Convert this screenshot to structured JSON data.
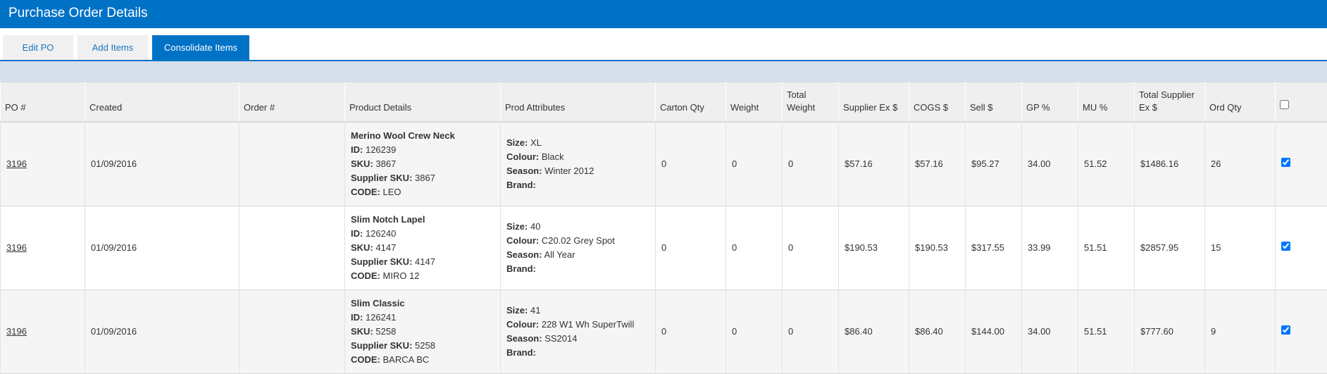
{
  "header": {
    "title": "Purchase Order Details"
  },
  "tabs": [
    {
      "label": "Edit PO",
      "active": false
    },
    {
      "label": "Add Items",
      "active": false
    },
    {
      "label": "Consolidate Items",
      "active": true
    }
  ],
  "table": {
    "columns": [
      "PO #",
      "Created",
      "Order #",
      "Product Details",
      "Prod Attributes",
      "Carton Qty",
      "Weight",
      "Total Weight",
      "Supplier Ex $",
      "COGS $",
      "Sell $",
      "GP %",
      "MU %",
      "Total Supplier Ex $",
      "Ord Qty"
    ],
    "header_checked": false,
    "detail_labels": {
      "id": "ID:",
      "sku": "SKU:",
      "supplier_sku": "Supplier SKU:",
      "code": "CODE:"
    },
    "attr_labels": {
      "size": "Size:",
      "colour": "Colour:",
      "season": "Season:",
      "brand": "Brand:"
    },
    "rows": [
      {
        "po": "3196",
        "created": "01/09/2016",
        "order": "",
        "name": "Merino Wool Crew Neck",
        "id": "126239",
        "sku": "3867",
        "supplier_sku": "3867",
        "code": "LEO",
        "size": "XL",
        "colour": "Black",
        "season": "Winter 2012",
        "brand": "",
        "carton_qty": "0",
        "weight": "0",
        "total_weight": "0",
        "supplier_ex": "$57.16",
        "cogs": "$57.16",
        "sell": "$95.27",
        "gp": "34.00",
        "mu": "51.52",
        "total_supplier_ex": "$1486.16",
        "ord_qty": "26",
        "checked": true
      },
      {
        "po": "3196",
        "created": "01/09/2016",
        "order": "",
        "name": "Slim Notch Lapel",
        "id": "126240",
        "sku": "4147",
        "supplier_sku": "4147",
        "code": "MIRO 12",
        "size": "40",
        "colour": "C20.02 Grey Spot",
        "season": "All Year",
        "brand": "",
        "carton_qty": "0",
        "weight": "0",
        "total_weight": "0",
        "supplier_ex": "$190.53",
        "cogs": "$190.53",
        "sell": "$317.55",
        "gp": "33.99",
        "mu": "51.51",
        "total_supplier_ex": "$2857.95",
        "ord_qty": "15",
        "checked": true
      },
      {
        "po": "3196",
        "created": "01/09/2016",
        "order": "",
        "name": "Slim Classic",
        "id": "126241",
        "sku": "5258",
        "supplier_sku": "5258",
        "code": "BARCA BC",
        "size": "41",
        "colour": "228 W1 Wh SuperTwill",
        "season": "SS2014",
        "brand": "",
        "carton_qty": "0",
        "weight": "0",
        "total_weight": "0",
        "supplier_ex": "$86.40",
        "cogs": "$86.40",
        "sell": "$144.00",
        "gp": "34.00",
        "mu": "51.51",
        "total_supplier_ex": "$777.60",
        "ord_qty": "9",
        "checked": true
      }
    ]
  }
}
